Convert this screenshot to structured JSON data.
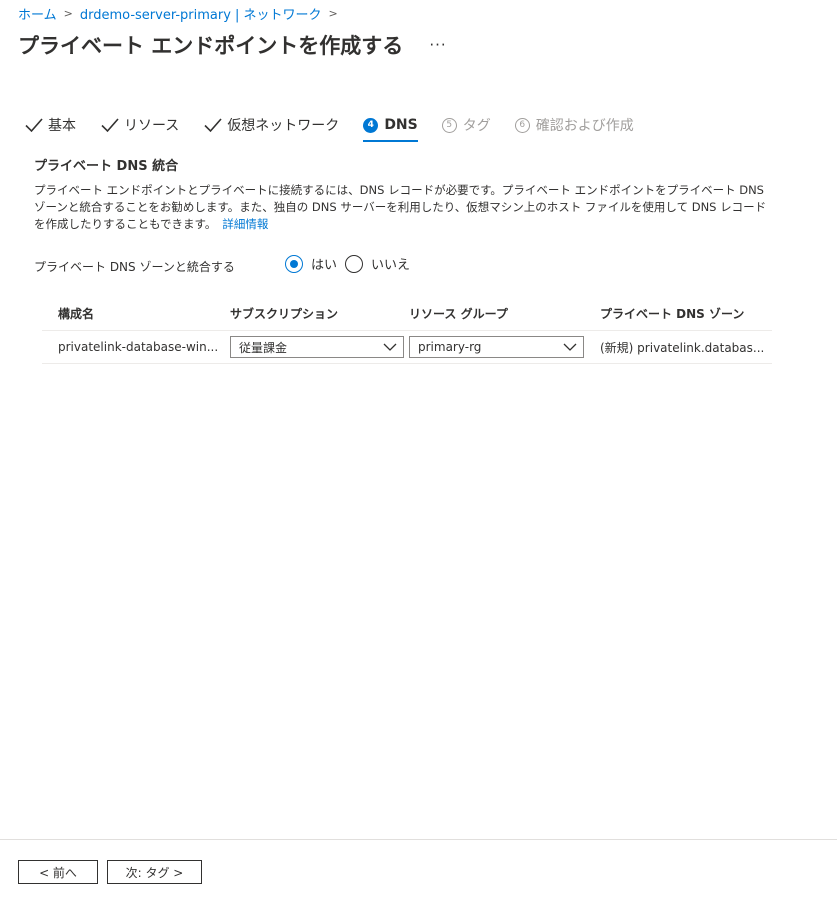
{
  "breadcrumb": [
    {
      "label": "ホーム"
    },
    {
      "label": "drdemo-server-primary | ネットワーク"
    }
  ],
  "page": {
    "title": "プライベート エンドポイントを作成する",
    "more": "···"
  },
  "steps": [
    {
      "label": "基本",
      "state": "done"
    },
    {
      "label": "リソース",
      "state": "done"
    },
    {
      "label": "仮想ネットワーク",
      "state": "done"
    },
    {
      "num": "4",
      "label": "DNS",
      "state": "active"
    },
    {
      "num": "5",
      "label": "タグ",
      "state": "disabled"
    },
    {
      "num": "6",
      "label": "確認および作成",
      "state": "disabled"
    }
  ],
  "section": {
    "title": "プライベート DNS 統合",
    "description": "プライベート エンドポイントとプライベートに接続するには、DNS レコードが必要です。プライベート エンドポイントをプライベート DNS ゾーンと統合することをお勧めします。また、独自の DNS サーバーを利用したり、仮想マシン上のホスト ファイルを使用して DNS レコードを作成したりすることもできます。",
    "learn_more": "詳細情報"
  },
  "integrate": {
    "label": "プライベート DNS ゾーンと統合する",
    "options": [
      {
        "label": "はい",
        "checked": true
      },
      {
        "label": "いいえ",
        "checked": false
      }
    ]
  },
  "table": {
    "headers": [
      "構成名",
      "サブスクリプション",
      "リソース グループ",
      "プライベート DNS ゾーン"
    ],
    "rows": [
      {
        "config_name": "privatelink-database-win...",
        "subscription": "従量課金",
        "resource_group": "primary-rg",
        "dns_zone": "(新規) privatelink.databas..."
      }
    ]
  },
  "footer": {
    "prev_label": "< 前へ",
    "next_label": "次: タグ >"
  },
  "colors": {
    "accent": "#0078d4",
    "text": "#323130",
    "disabled": "#a19f9d"
  }
}
